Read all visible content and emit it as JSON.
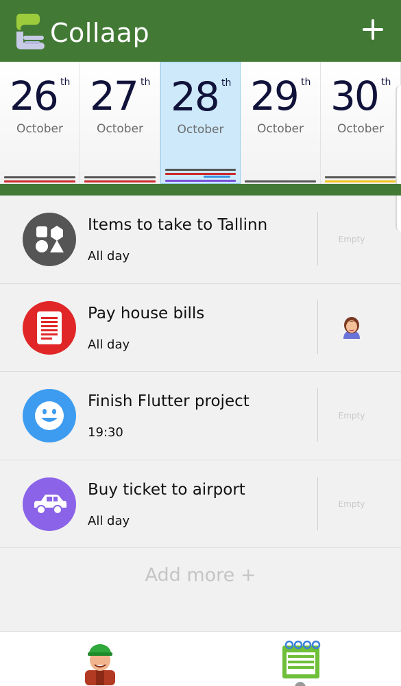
{
  "app": {
    "title": "Collaap"
  },
  "colors": {
    "brand_green": "#427a35",
    "selected_blue": "#cde9fa"
  },
  "dates": [
    {
      "day": "26",
      "suffix": "th",
      "month": "October",
      "bars": [
        "#555555",
        "#cc2a2a"
      ]
    },
    {
      "day": "27",
      "suffix": "th",
      "month": "October",
      "bars": [
        "#555555",
        "#cc2a2a"
      ]
    },
    {
      "day": "28",
      "suffix": "th",
      "month": "October",
      "selected": true,
      "bars": [
        "#555555",
        "#cc2a2a",
        "#3a8fe0",
        "#7a4fd8"
      ]
    },
    {
      "day": "29",
      "suffix": "th",
      "month": "October",
      "bars": [
        "#555555"
      ]
    },
    {
      "day": "30",
      "suffix": "th",
      "month": "October",
      "bars": [
        "#555555",
        "#f0c419"
      ]
    }
  ],
  "tasks": [
    {
      "title": "Items to take to Tallinn",
      "time": "All day",
      "icon": "shapes-icon",
      "icon_color": "#555555",
      "assignee": "Empty"
    },
    {
      "title": "Pay house bills",
      "time": "All day",
      "icon": "bill-icon",
      "icon_color": "#e02626",
      "assignee": "avatar"
    },
    {
      "title": "Finish Flutter project",
      "time": "19:30",
      "icon": "smiley-icon",
      "icon_color": "#3d9cf0",
      "assignee": "Empty"
    },
    {
      "title": "Buy ticket to airport",
      "time": "All day",
      "icon": "car-icon",
      "icon_color": "#8a63e8",
      "assignee": "Empty"
    }
  ],
  "add_more": "Add more +",
  "nav": {
    "profile": "profile-avatar-icon",
    "calendar": "calendar-icon"
  }
}
